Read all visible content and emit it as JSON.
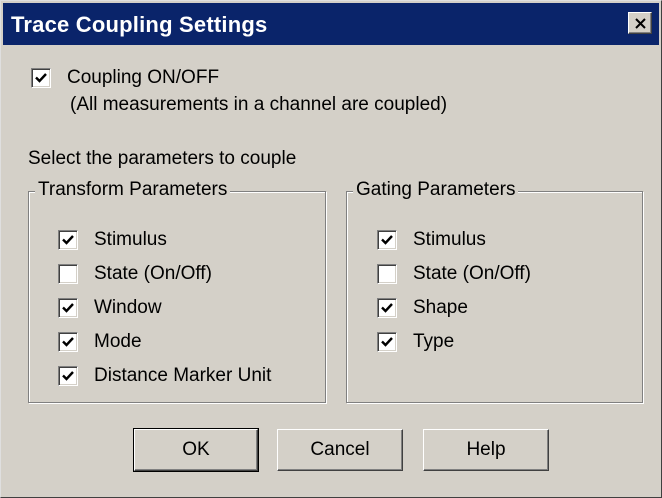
{
  "window": {
    "title": "Trace Coupling Settings"
  },
  "coupling": {
    "label": "Coupling ON/OFF",
    "checked": true,
    "note": "(All measurements in a channel are coupled)"
  },
  "instruction": "Select the parameters to couple",
  "transform_group": {
    "title": "Transform Parameters",
    "items": [
      {
        "label": "Stimulus",
        "checked": true
      },
      {
        "label": "State (On/Off)",
        "checked": false
      },
      {
        "label": "Window",
        "checked": true
      },
      {
        "label": "Mode",
        "checked": true
      },
      {
        "label": "Distance Marker Unit",
        "checked": true
      }
    ]
  },
  "gating_group": {
    "title": "Gating Parameters",
    "items": [
      {
        "label": "Stimulus",
        "checked": true
      },
      {
        "label": "State (On/Off)",
        "checked": false
      },
      {
        "label": "Shape",
        "checked": true
      },
      {
        "label": "Type",
        "checked": true
      }
    ]
  },
  "buttons": {
    "ok": "OK",
    "cancel": "Cancel",
    "help": "Help"
  }
}
